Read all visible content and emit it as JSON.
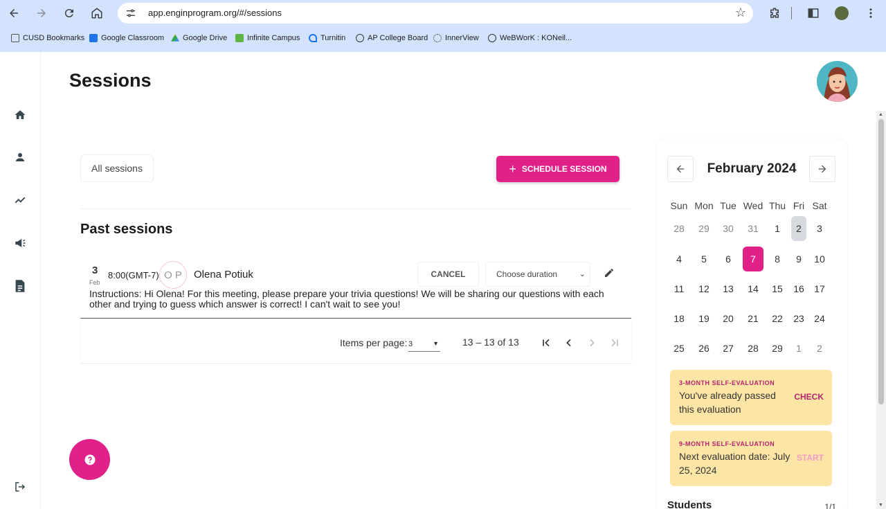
{
  "browser": {
    "url": "app.enginprogram.org/#/sessions",
    "bookmarks": [
      "CUSD Bookmarks",
      "Google Classroom",
      "Google Drive",
      "Infinite Campus",
      "Turnitin",
      "AP College Board",
      "InnerView",
      "WeBWorK : KONeil..."
    ]
  },
  "page": {
    "title": "Sessions",
    "filter_label": "All sessions",
    "schedule_label": "SCHEDULE SESSION",
    "past_title": "Past sessions"
  },
  "session": {
    "day": "3",
    "month": "Feb",
    "time": "8:00(GMT-7)",
    "initials": "O P",
    "student": "Olena Potiuk",
    "cancel_label": "CANCEL",
    "duration_placeholder": "Choose duration",
    "instructions": "Instructions: Hi Olena! For this meeting, please prepare your trivia questions! We will be sharing our questions with each other and trying to guess which answer is correct! I can't wait to see you!"
  },
  "pager": {
    "items_label": "Items per page:",
    "items_value": "3",
    "range": "13 – 13 of 13"
  },
  "calendar": {
    "title": "February 2024",
    "dow": [
      "Sun",
      "Mon",
      "Tue",
      "Wed",
      "Thu",
      "Fri",
      "Sat"
    ],
    "weeks": [
      [
        "28",
        "29",
        "30",
        "31",
        "1",
        "2",
        "3"
      ],
      [
        "4",
        "5",
        "6",
        "7",
        "8",
        "9",
        "10"
      ],
      [
        "11",
        "12",
        "13",
        "14",
        "15",
        "16",
        "17"
      ],
      [
        "18",
        "19",
        "20",
        "21",
        "22",
        "23",
        "24"
      ],
      [
        "25",
        "26",
        "27",
        "28",
        "29",
        "1",
        "2"
      ]
    ],
    "selected_day": "7",
    "highlighted_day": "2"
  },
  "evaluations": [
    {
      "title": "3-MONTH SELF-EVALUATION",
      "text": "You've already passed this evaluation",
      "action": "CHECK"
    },
    {
      "title": "9-MONTH SELF-EVALUATION",
      "text": "Next evaluation date: July 25, 2024",
      "action": "START"
    }
  ],
  "students": {
    "label": "Students",
    "count": "1/1"
  },
  "colors": {
    "accent": "#e0218a",
    "eval_bg": "#fde5a6",
    "browser_bar": "#d3e3fd"
  }
}
